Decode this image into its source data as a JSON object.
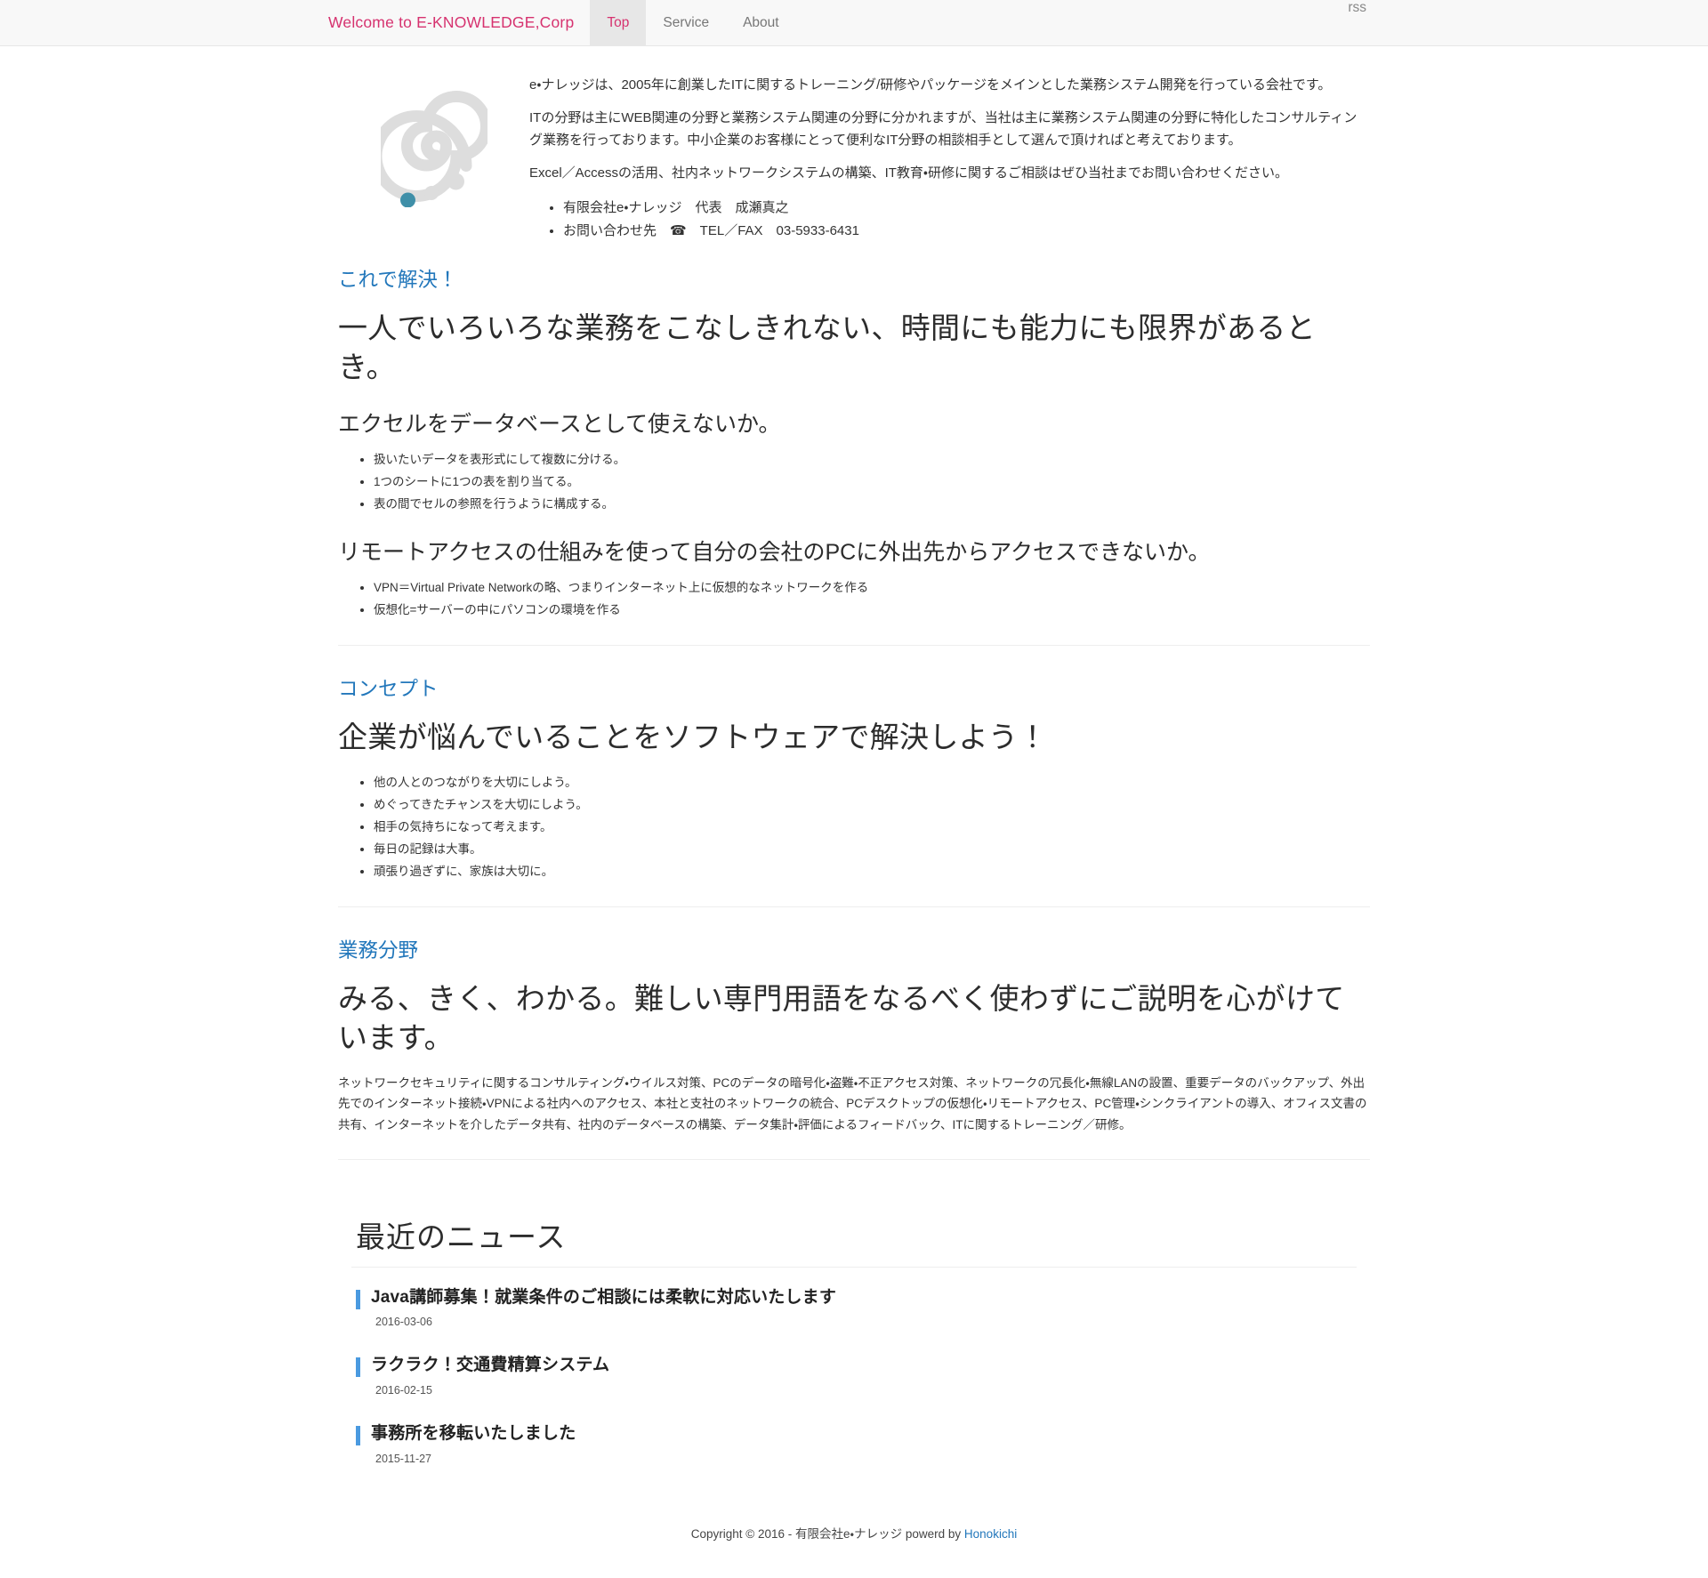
{
  "navbar": {
    "brand": "Welcome to E-KNOWLEDGE,Corp",
    "brand_color": "#d6326f",
    "items": [
      {
        "label": "Top",
        "active": true
      },
      {
        "label": "Service",
        "active": false
      },
      {
        "label": "About",
        "active": false
      }
    ],
    "right_items": [
      {
        "label": "rss"
      }
    ]
  },
  "hero": {
    "logo_icon": "spiral-logo-icon",
    "logo_colors": {
      "spiral": "#dddddd",
      "dot_accent": "#3f8fa8"
    },
    "paragraphs": [
      "e・ナレッジは、2005年に創業したITに関するトレーニング/研修やパッケージをメインとした業務システム開発を行っている会社です。",
      "ITの分野は主にWEB関連の分野と業務システム関連の分野に分かれますが、当社は主に業務システム関連の分野に特化したコンサルティング業務を行っております。中小企業のお客様にとって便利なIT分野の相談相手として選んで頂ければと考えております。",
      "Excel／Accessの活用、社内ネットワークシステムの構築、IT教育・研修に関するご相談はぜひ当社までお問い合わせください。"
    ],
    "contact_list": [
      "有限会社e・ナレッジ　代表　成瀬真之",
      "お問い合わせ先　☎　TEL／FAX　03-5933-6431"
    ]
  },
  "sections": [
    {
      "eyebrow": "これで解決！",
      "eyebrow_color": "#2277bb",
      "headline": "一人でいろいろな業務をこなしきれない、時間にも能力にも限界があるとき。",
      "subsections": [
        {
          "title": "エクセルをデータベースとして使えないか。",
          "bullets": [
            "扱いたいデータを表形式にして複数に分ける。",
            "1つのシートに1つの表を割り当てる。",
            "表の間でセルの参照を行うように構成する。"
          ]
        },
        {
          "title": "リモートアクセスの仕組みを使って自分の会社のPCに外出先からアクセスできないか。",
          "bullets": [
            "VPN＝Virtual Private Networkの略、つまりインターネット上に仮想的なネットワークを作る",
            "仮想化=サーバーの中にパソコンの環境を作る"
          ]
        }
      ],
      "body": ""
    },
    {
      "eyebrow": "コンセプト",
      "eyebrow_color": "#2277bb",
      "headline": "企業が悩んでいることをソフトウェアで解決しよう！",
      "subsections": [
        {
          "title": "",
          "bullets": [
            "他の人とのつながりを大切にしよう。",
            "めぐってきたチャンスを大切にしよう。",
            "相手の気持ちになって考えます。",
            "毎日の記録は大事。",
            "頑張り過ぎずに、家族は大切に。"
          ]
        }
      ],
      "body": ""
    },
    {
      "eyebrow": "業務分野",
      "eyebrow_color": "#2277bb",
      "headline": "みる、きく、わかる。難しい専門用語をなるべく使わずにご説明を心がけています。",
      "subsections": [],
      "body": "ネットワークセキュリティに関するコンサルティング・ウイルス対策、PCのデータの暗号化・盗難・不正アクセス対策、ネットワークの冗長化・無線LANの設置、重要データのバックアップ、外出先でのインターネット接続・VPNによる社内へのアクセス、本社と支社のネットワークの統合、PCデスクトップの仮想化・リモートアクセス、PC管理・シンクライアントの導入、オフィス文書の共有、インターネットを介したデータ共有、社内のデータベースの構築、データ集計・評価によるフィードバック、ITに関するトレーニング／研修。"
    }
  ],
  "news": {
    "title": "最近のニュース",
    "accent_color": "#4a9ae0",
    "items": [
      {
        "headline": "Java講師募集！就業条件のご相談には柔軟に対応いたします",
        "date": "2016-03-06"
      },
      {
        "headline": "ラクラク！交通費精算システム",
        "date": "2016-02-15"
      },
      {
        "headline": "事務所を移転いたしました",
        "date": "2015-11-27"
      }
    ]
  },
  "footer": {
    "copyright_prefix": "Copyright © 2016 - 有限会社e・ナレッジ powerd by ",
    "credit_link": "Honokichi"
  }
}
